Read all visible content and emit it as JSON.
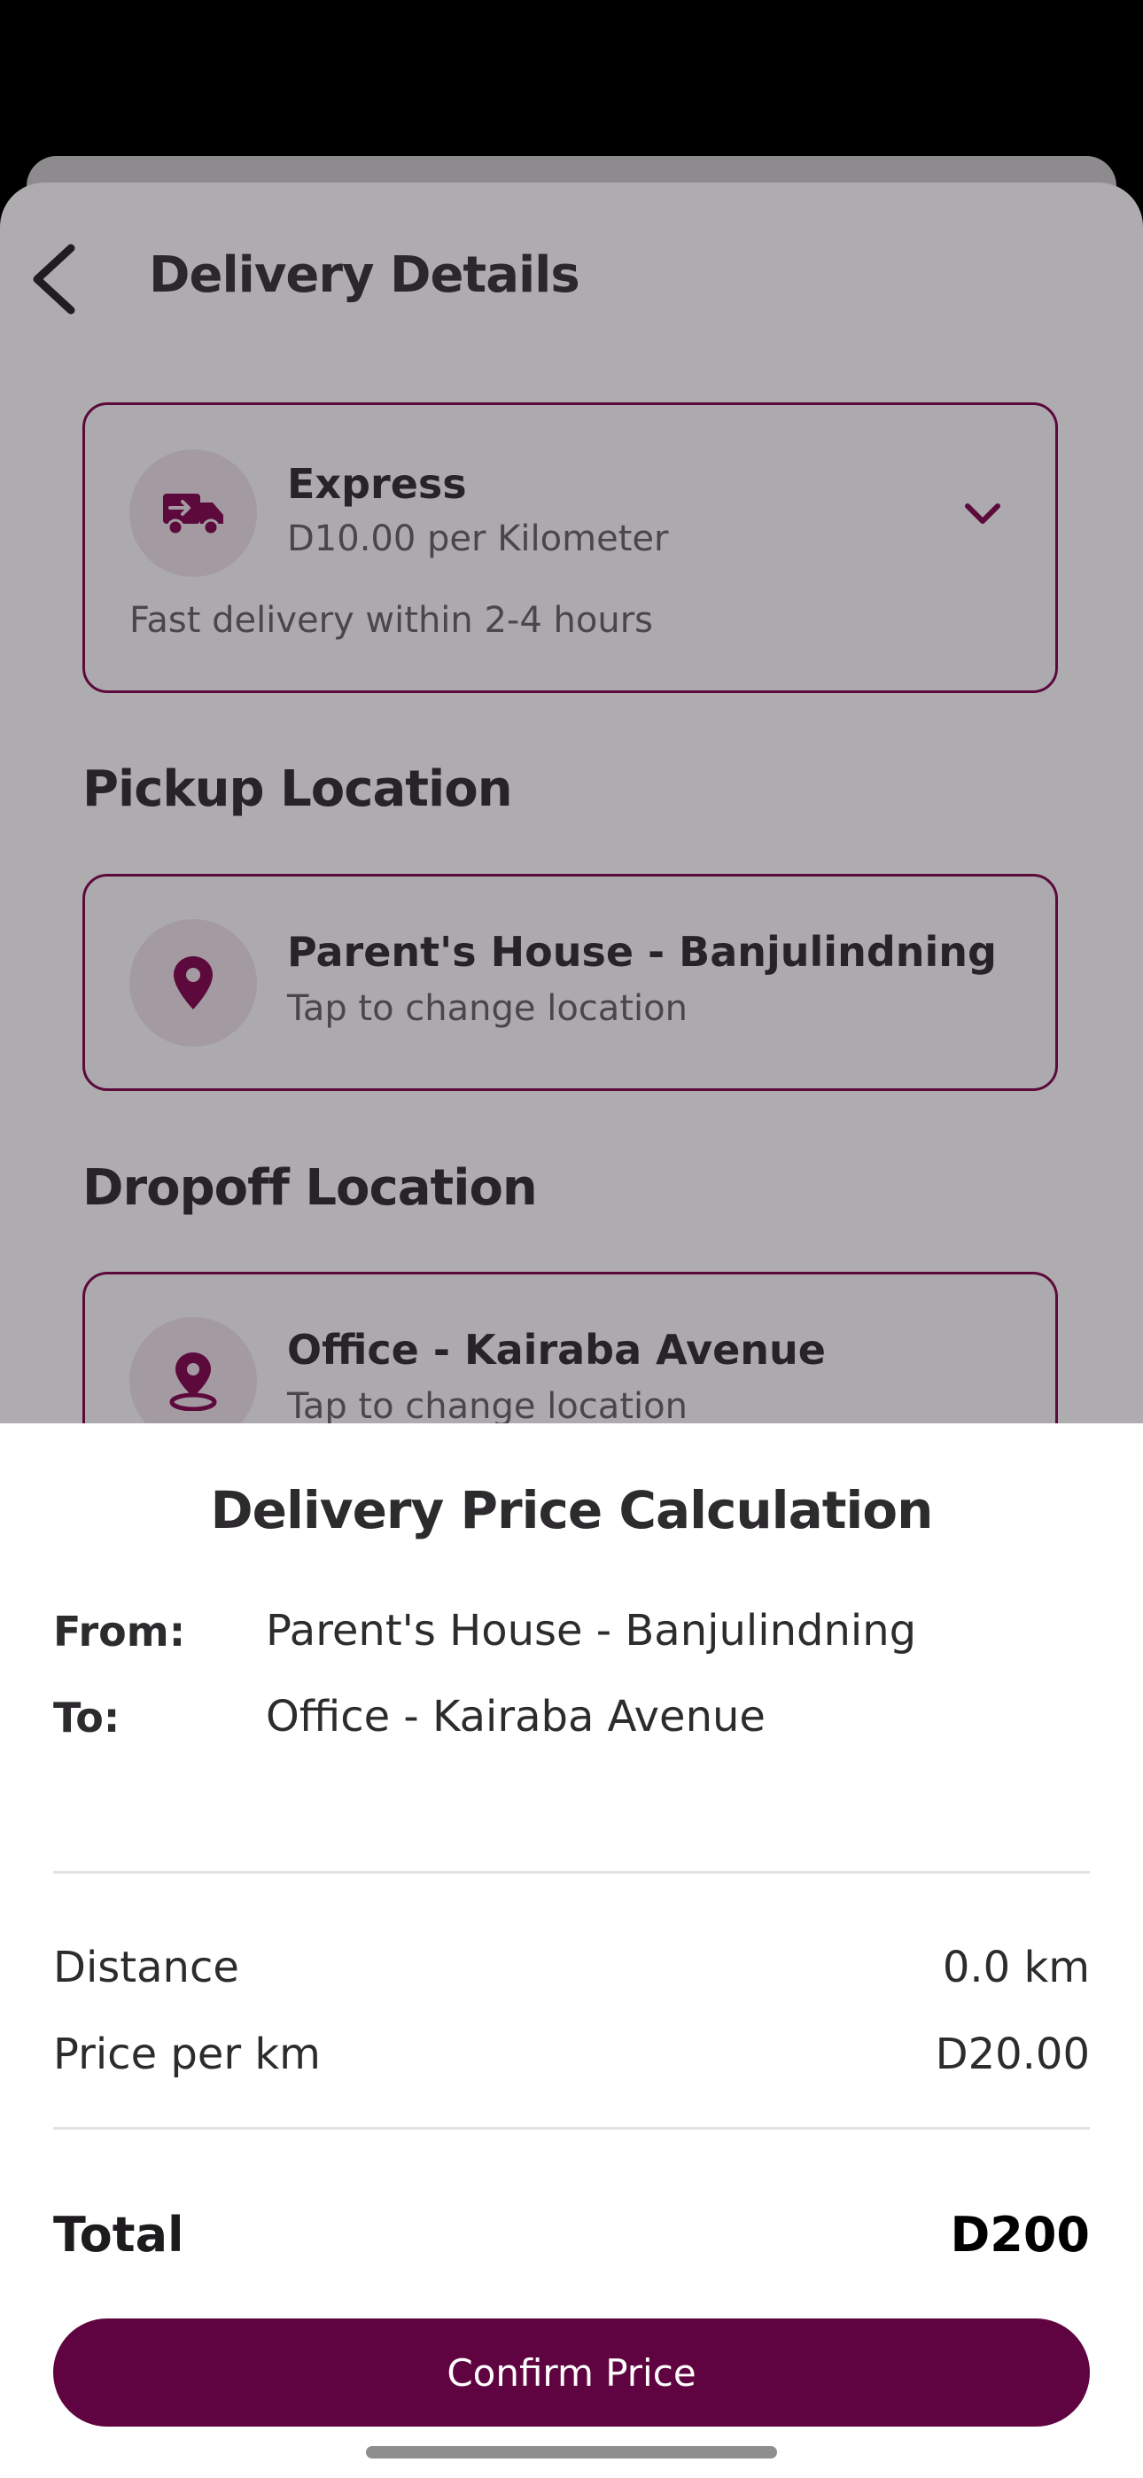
{
  "header": {
    "title": "Delivery Details"
  },
  "delivery_option": {
    "name": "Express",
    "rate": "D10.00 per Kilometer",
    "description": "Fast delivery within 2-4 hours",
    "icon": "truck-icon"
  },
  "pickup": {
    "heading": "Pickup Location",
    "name": "Parent's House - Banjulindning",
    "hint": "Tap to change location",
    "icon": "map-pin-icon"
  },
  "dropoff": {
    "heading": "Dropoff Location",
    "name": "Office - Kairaba Avenue",
    "hint": "Tap to change location",
    "icon": "map-pin-target-icon"
  },
  "modal": {
    "title": "Delivery Price Calculation",
    "from_label": "From:",
    "from_value": "Parent's House - Banjulindning",
    "to_label": "To:",
    "to_value": "Office - Kairaba Avenue",
    "distance_label": "Distance",
    "distance_value": "0.0 km",
    "price_label": "Price per km",
    "price_value": "D20.00",
    "total_label": "Total",
    "total_value": "D200",
    "confirm_label": "Confirm Price"
  },
  "colors": {
    "brand": "#5f0440",
    "overlay_bg": "#aeacaf",
    "card_border": "#5c0a3c"
  }
}
